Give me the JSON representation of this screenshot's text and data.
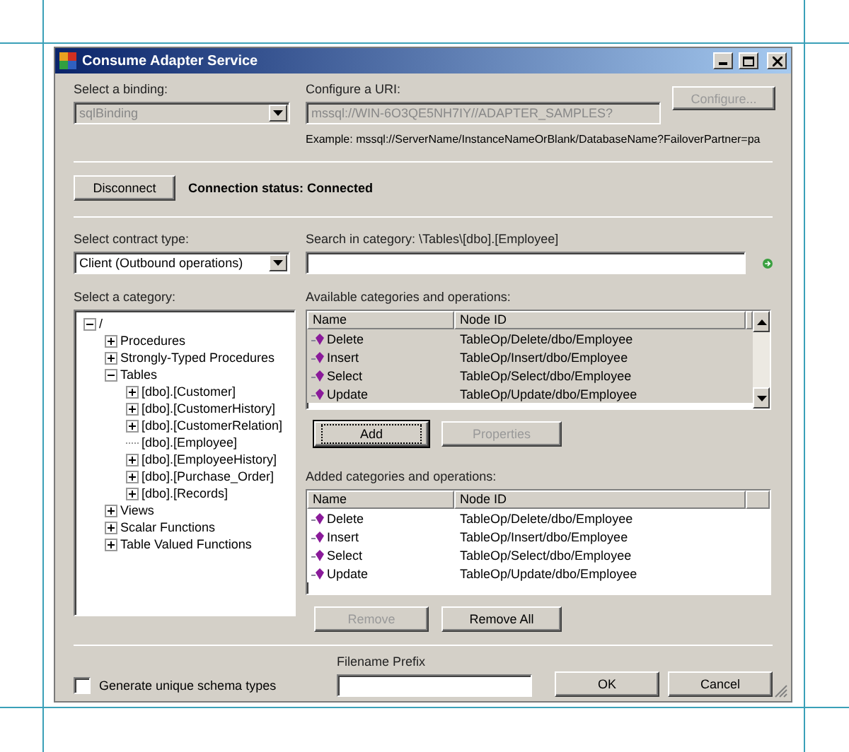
{
  "window": {
    "title": "Consume Adapter Service"
  },
  "binding": {
    "label": "Select a binding:",
    "value": "sqlBinding",
    "disabled": true
  },
  "uri": {
    "label": "Configure a URI:",
    "value": "mssql://WIN-6O3QE5NH7IY//ADAPTER_SAMPLES?",
    "disabled": true,
    "example": "Example: mssql://ServerName/InstanceNameOrBlank/DatabaseName?FailoverPartner=pa"
  },
  "configure_button": {
    "label": "Configure...",
    "disabled": true
  },
  "connection": {
    "button": "Disconnect",
    "status": "Connection status: Connected"
  },
  "contract": {
    "label": "Select contract type:",
    "value": "Client (Outbound operations)"
  },
  "search": {
    "label": "Search in category: \\Tables\\[dbo].[Employee]"
  },
  "category_tree": {
    "label": "Select a category:",
    "items": [
      {
        "label": "/",
        "expanded": true,
        "children": [
          {
            "label": "Procedures",
            "expanded": false
          },
          {
            "label": "Strongly-Typed Procedures",
            "expanded": false
          },
          {
            "label": "Tables",
            "expanded": true,
            "children": [
              {
                "label": "[dbo].[Customer]",
                "expanded": false
              },
              {
                "label": "[dbo].[CustomerHistory]",
                "expanded": false
              },
              {
                "label": "[dbo].[CustomerRelation]",
                "expanded": false
              },
              {
                "label": "[dbo].[Employee]"
              },
              {
                "label": "[dbo].[EmployeeHistory]",
                "expanded": false
              },
              {
                "label": "[dbo].[Purchase_Order]",
                "expanded": false
              },
              {
                "label": "[dbo].[Records]",
                "expanded": false
              }
            ]
          },
          {
            "label": "Views",
            "expanded": false
          },
          {
            "label": "Scalar Functions",
            "expanded": false
          },
          {
            "label": "Table Valued Functions",
            "expanded": false
          }
        ]
      }
    ]
  },
  "available": {
    "label": "Available categories and operations:",
    "columns": [
      "Name",
      "Node ID"
    ],
    "rows": [
      {
        "name": "Delete",
        "node_id": "TableOp/Delete/dbo/Employee",
        "selected": true
      },
      {
        "name": "Insert",
        "node_id": "TableOp/Insert/dbo/Employee",
        "selected": true
      },
      {
        "name": "Select",
        "node_id": "TableOp/Select/dbo/Employee",
        "selected": true
      },
      {
        "name": "Update",
        "node_id": "TableOp/Update/dbo/Employee",
        "selected": true
      }
    ]
  },
  "available_buttons": [
    {
      "label": "Add",
      "disabled": false,
      "focused": true
    },
    {
      "label": "Properties",
      "disabled": true,
      "focused": false
    }
  ],
  "added": {
    "label": "Added categories and operations:",
    "columns": [
      "Name",
      "Node ID"
    ],
    "rows": [
      {
        "name": "Delete",
        "node_id": "TableOp/Delete/dbo/Employee",
        "selected": false
      },
      {
        "name": "Insert",
        "node_id": "TableOp/Insert/dbo/Employee",
        "selected": false
      },
      {
        "name": "Select",
        "node_id": "TableOp/Select/dbo/Employee",
        "selected": false
      },
      {
        "name": "Update",
        "node_id": "TableOp/Update/dbo/Employee",
        "selected": false
      }
    ]
  },
  "added_buttons": [
    {
      "label": "Remove",
      "disabled": true,
      "focused": false
    },
    {
      "label": "Remove All",
      "disabled": false,
      "focused": false
    }
  ],
  "generate_unique": {
    "label": "Generate unique schema types",
    "checked": false
  },
  "filename_prefix": {
    "label": "Filename Prefix"
  },
  "buttons": [
    "OK",
    "Cancel"
  ]
}
